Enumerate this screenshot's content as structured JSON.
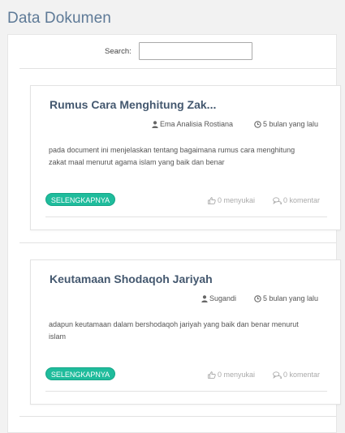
{
  "page": {
    "title": "Data Dokumen"
  },
  "search": {
    "label": "Search:",
    "value": "",
    "placeholder": ""
  },
  "documents": [
    {
      "title": "Rumus Cara Menghitung Zak...",
      "author": "Ema Analisia Rostiana",
      "time": "5 bulan yang lalu",
      "description": "pada document ini menjelaskan tentang bagaimana rumus cara menghitung zakat maal menurut agama islam yang baik dan benar",
      "button_label": "SELENGKAPNYA",
      "likes": "0 menyukai",
      "comments": "0 komentar"
    },
    {
      "title": "Keutamaan Shodaqoh Jariyah",
      "author": "Sugandi",
      "time": "5 bulan yang lalu",
      "description": "adapun keutamaan dalam bershodaqoh jariyah yang baik dan benar menurut islam",
      "button_label": "SELENGKAPNYA",
      "likes": "0 menyukai",
      "comments": "0 komentar"
    }
  ],
  "colors": {
    "accent": "#1fbc9c",
    "title": "#5e7a97",
    "card_title": "#44586f"
  },
  "icons": {
    "author": "user-icon",
    "time": "clock-icon",
    "likes": "thumbs-up-icon",
    "comments": "comment-icon"
  }
}
